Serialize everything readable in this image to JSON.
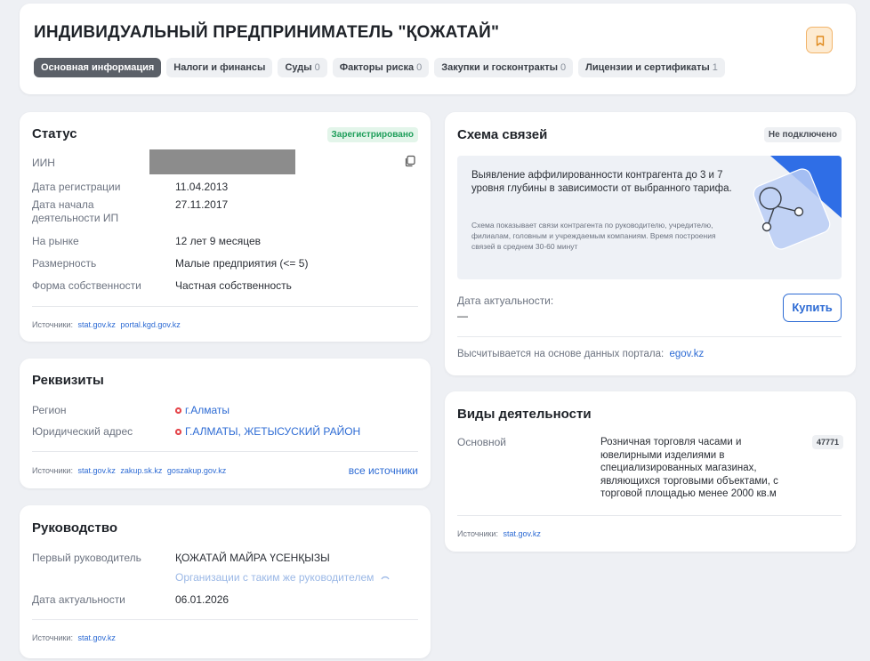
{
  "header": {
    "title": "ИНДИВИДУАЛЬНЫЙ ПРЕДПРИНИМАТЕЛЬ \"ҚОЖАТАЙ\"",
    "tabs": [
      {
        "label": "Основная информация",
        "count": ""
      },
      {
        "label": "Налоги и финансы",
        "count": ""
      },
      {
        "label": "Суды",
        "count": "0"
      },
      {
        "label": "Факторы риска",
        "count": "0"
      },
      {
        "label": "Закупки и госконтракты",
        "count": "0"
      },
      {
        "label": "Лицензии и сертификаты",
        "count": "1"
      }
    ],
    "bookmark_icon": "bookmark-icon"
  },
  "status": {
    "title": "Статус",
    "badge": "Зарегистрировано",
    "badge_color": "#1e9e5a",
    "iin_label": "ИИН",
    "reg_date_label": "Дата регистрации",
    "reg_date": "11.04.2013",
    "start_label": "Дата начала деятельности ИП",
    "start_date": "27.11.2017",
    "market_label": "На рынке",
    "market": "12 лет 9 месяцев",
    "size_label": "Размерность",
    "size": "Малые предприятия (<= 5)",
    "ownership_label": "Форма собственности",
    "ownership": "Частная собственность",
    "sources_label": "Источники:",
    "sources": [
      "stat.gov.kz",
      "portal.kgd.gov.kz"
    ]
  },
  "requisites": {
    "title": "Реквизиты",
    "region_label": "Регион",
    "region": "г.Алматы",
    "address_label": "Юридический адрес",
    "address": "Г.АЛМАТЫ, ЖЕТЫСУСКИЙ РАЙОН",
    "sources_label": "Источники:",
    "sources": [
      "stat.gov.kz",
      "zakup.sk.kz",
      "goszakup.gov.kz"
    ],
    "all_sources": "все источники"
  },
  "management": {
    "title": "Руководство",
    "head_label": "Первый руководитель",
    "head": "ҚОЖАТАЙ МАЙРА ҮСЕНҚЫЗЫ",
    "same_head_link": "Организации с таким же руководителем",
    "date_label": "Дата актуальности",
    "date": "06.01.2026",
    "sources_label": "Источники:",
    "sources": [
      "stat.gov.kz"
    ]
  },
  "links_scheme": {
    "title": "Схема связей",
    "badge": "Не подключено",
    "promo_main": "Выявление аффилированности контрагента до 3 и 7 уровня глубины в зависимости от выбранного тарифа.",
    "promo_small": "Схема показывает связи контрагента по руководителю, учредителю, филиалам, головным и учреждаемым компаниям. Время построения связей в среднем 30-60 минут",
    "date_label": "Дата актуальности:",
    "date_value": "—",
    "buy_button": "Купить",
    "footer_text": "Высчитывается на основе данных портала:",
    "footer_link": "egov.kz"
  },
  "activities": {
    "title": "Виды деятельности",
    "main_label": "Основной",
    "main_text": "Розничная торговля часами и ювелирными изделиями в специализированных магазинах, являющихся торговыми объектами, с торговой площадью менее 2000 кв.м",
    "code": "47771",
    "sources_label": "Источники:",
    "sources": [
      "stat.gov.kz"
    ]
  }
}
